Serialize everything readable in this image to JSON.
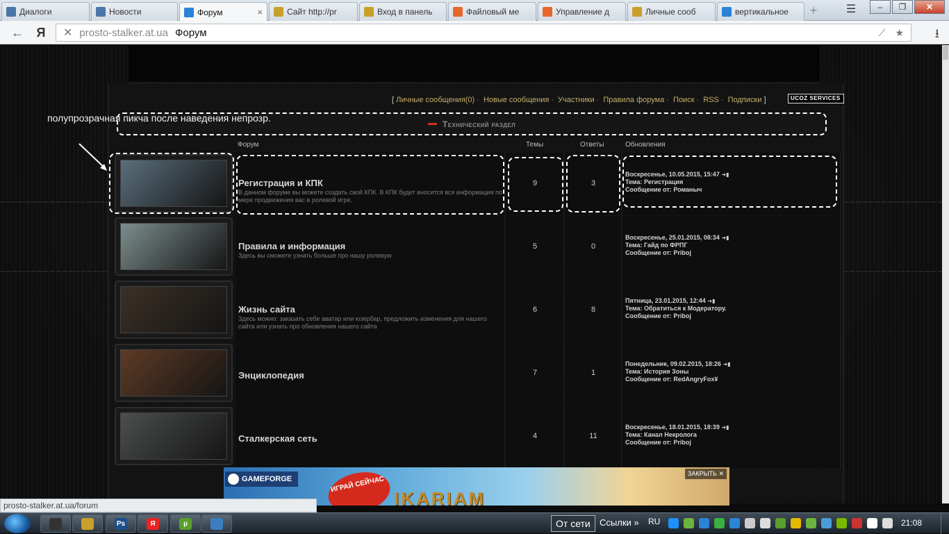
{
  "browser": {
    "tabs": [
      {
        "label": "Диалоги",
        "icon": "vk",
        "color": "#4a76a8"
      },
      {
        "label": "Новости",
        "icon": "vk",
        "color": "#4a76a8"
      },
      {
        "label": "Форум",
        "icon": "loading",
        "color": "#2b84d6",
        "active": true
      },
      {
        "label": "Сайт http://pr",
        "icon": "radiation",
        "color": "#c8a02a"
      },
      {
        "label": "Вход в панель",
        "icon": "radiation",
        "color": "#c8a02a"
      },
      {
        "label": "Файловый ме",
        "icon": "ucoz",
        "color": "#e8662a"
      },
      {
        "label": "Управление д",
        "icon": "ucoz",
        "color": "#e8662a"
      },
      {
        "label": "Личные сооб",
        "icon": "radiation",
        "color": "#c8a02a"
      },
      {
        "label": "вертикальное",
        "icon": "search",
        "color": "#2b84d6"
      }
    ],
    "close_tab": "×",
    "new_tab": "+",
    "menu_icon": "☰",
    "minimize": "–",
    "maximize": "❐",
    "close_window": "✕",
    "back_icon": "←",
    "yandex_logo": "Я",
    "stop_icon": "✕",
    "address_host": "prosto-stalker.at.ua",
    "address_title": "Форум",
    "download_icon": "⭳",
    "status_url": "prosto-stalker.at.ua/forum"
  },
  "page": {
    "top_links": {
      "open_bracket": "[",
      "close_bracket": "]",
      "items": [
        "Личные сообщения(0)",
        "Новые сообщения",
        "Участники",
        "Правила форума",
        "Поиск",
        "RSS",
        "Подписки"
      ],
      "separator": "·"
    },
    "ucoz_badge": "UCOZ SERVICES",
    "annotation": "полупрозрачная пикча после наведения непрозр.",
    "section_title": "Технический раздел",
    "columns": {
      "forum": "Форум",
      "topics": "Темы",
      "replies": "Ответы",
      "updates": "Обновления"
    },
    "forums": [
      {
        "name": "Регистрация и КПК",
        "desc": "В данном форуме вы можете создать свой КПК. В КПК будет вносится вся информация по мере продвижения вас в ролевой игре.",
        "topics": "9",
        "replies": "3",
        "date": "Воскресенье, 10.05.2015, 15:47",
        "topic_label": "Тема:",
        "topic": "Регистрация",
        "author_label": "Сообщение от:",
        "author": "Романыч",
        "thumb_color": "#5a6f7c"
      },
      {
        "name": "Правила и информация",
        "desc": "Здесь вы сможете узнать больше про нашу ролевую",
        "topics": "5",
        "replies": "0",
        "date": "Воскресенье, 25.01.2015, 08:34",
        "topic_label": "Тема:",
        "topic": "Гайд по ФРПГ",
        "author_label": "Сообщение от:",
        "author": "Priboj",
        "thumb_color": "#7d8e8e"
      },
      {
        "name": "Жизнь сайта",
        "desc": "Здесь можно: заказать себе аватар или юзербар, предложить изменения для нашего сайта или узнать про обновления нашего сайта",
        "topics": "6",
        "replies": "8",
        "date": "Пятница, 23.01.2015, 12:44",
        "topic_label": "Тема:",
        "topic": "Обратиться к Модератору.",
        "author_label": "Сообщение от:",
        "author": "Priboj",
        "thumb_color": "#3b3026"
      },
      {
        "name": "Энциклопедия",
        "desc": "",
        "topics": "7",
        "replies": "1",
        "date": "Понедельник, 09.02.2015, 18:26",
        "topic_label": "Тема:",
        "topic": "История Зоны",
        "author_label": "Сообщение от:",
        "author": "RedAngryFox¥",
        "thumb_color": "#5e3a24"
      },
      {
        "name": "Сталкерская сеть",
        "desc": "",
        "topics": "4",
        "replies": "11",
        "date": "Воскресенье, 18.01.2015, 18:39",
        "topic_label": "Тема:",
        "topic": "Канал Некролога",
        "author_label": "Сообщение от:",
        "author": "Priboj",
        "thumb_color": "#4c4f4f"
      }
    ],
    "go_icon": "➜▮",
    "ad": {
      "brand": "GAMEFORGE",
      "cta": "ИГРАЙ СЕЙЧАС",
      "game": "IKARIAM",
      "close": "ЗАКРЫТЬ ✕"
    }
  },
  "taskbar": {
    "network": "От сети",
    "links": "Ссылки",
    "links_arrow": "»",
    "lang": "RU",
    "time": "21:08",
    "apps": [
      {
        "icon": "media-icon",
        "label": "",
        "color": "#333"
      },
      {
        "icon": "radiation-icon",
        "label": "",
        "color": "#c8a02a"
      },
      {
        "icon": "photoshop-icon",
        "label": "Ps",
        "color": "#1d4f8a"
      },
      {
        "icon": "yandex-icon",
        "label": "Я",
        "color": "#e22"
      },
      {
        "icon": "utorrent-icon",
        "label": "µ",
        "color": "#5aa02c"
      },
      {
        "icon": "monitor-icon",
        "label": "",
        "color": "#3b7dbf"
      }
    ],
    "tray_colors": [
      "#1e90ff",
      "#6cb33f",
      "#2b84d6",
      "#3cb043",
      "#2b84d6",
      "#ccc",
      "#ddd",
      "#5aa02c",
      "#e6b800",
      "#6cb33f",
      "#4c9ed9",
      "#76b900",
      "#c33",
      "#fff",
      "#ddd"
    ]
  }
}
